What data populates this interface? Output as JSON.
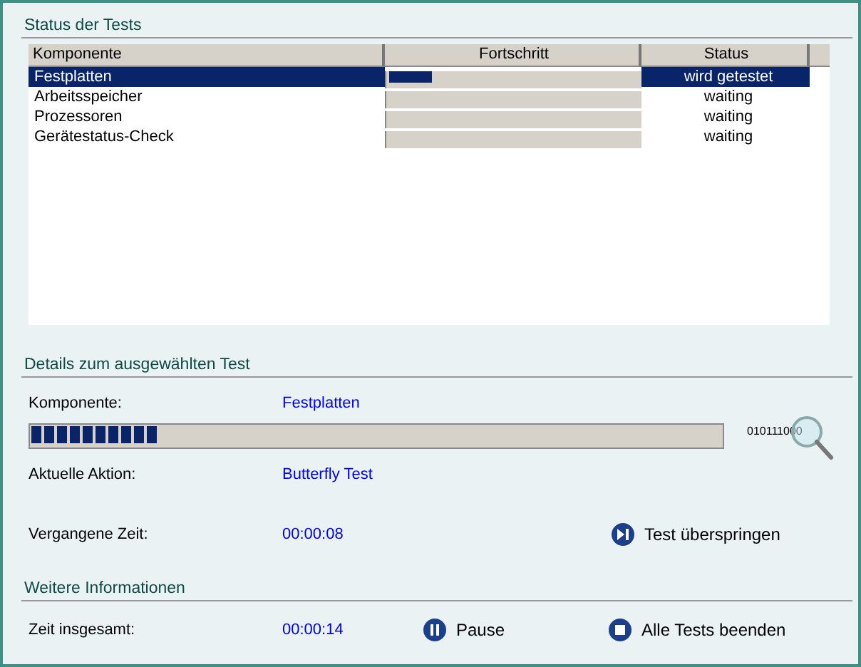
{
  "tests_section": {
    "heading": "Status der Tests",
    "table": {
      "columns": [
        "Komponente",
        "Fortschritt",
        "Status"
      ],
      "rows": [
        {
          "component": "Festplatten",
          "level": 0.17,
          "status": "wird getestet",
          "selected": true
        },
        {
          "component": "Arbeitsspeicher",
          "level": 0,
          "status": "waiting",
          "selected": false
        },
        {
          "component": "Prozessoren",
          "level": 0,
          "status": "waiting",
          "selected": false
        },
        {
          "component": "Gerätestatus-Check",
          "level": 0,
          "status": "waiting",
          "selected": false
        }
      ]
    }
  },
  "details_section": {
    "heading": "Details zum ausgewählten Test",
    "component_label": "Komponente:",
    "component_value": "Festplatten",
    "level": 0.185,
    "binary_icon_text": "010111000",
    "action_label": "Aktuelle Aktion:",
    "action_value": "Butterfly Test",
    "elapsed_label": "Vergangene Zeit:",
    "elapsed_value": "00:00:08",
    "skip_button": "Test überspringen"
  },
  "more_section": {
    "heading": "Weitere Informationen",
    "total_label": "Zeit insgesamt:",
    "total_value": "00:00:14",
    "pause_button": "Pause",
    "stop_button": "Alle Tests beenden"
  }
}
